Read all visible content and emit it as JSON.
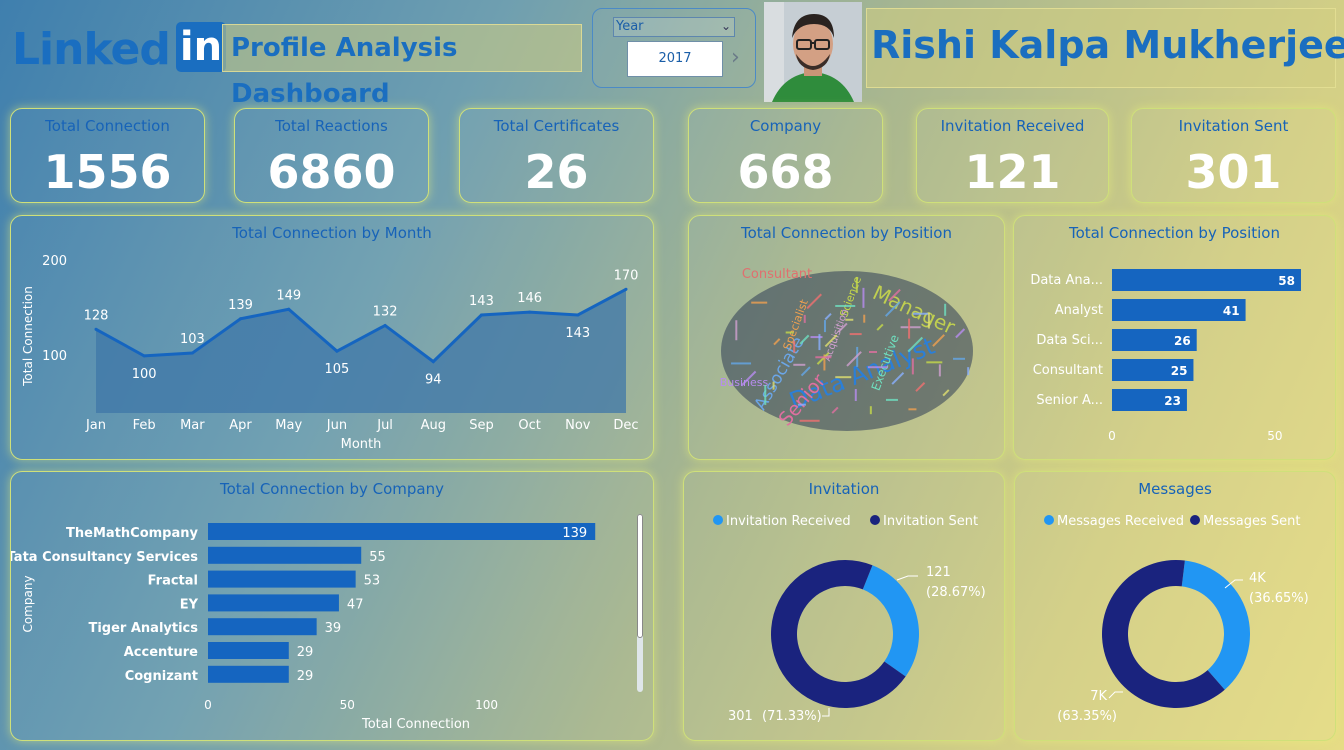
{
  "header": {
    "logo_word": "Linked",
    "logo_box": "in",
    "title": "Profile Analysis Dashboard",
    "user_name": "Rishi Kalpa Mukherjee"
  },
  "filter": {
    "label": "Year",
    "value": "2017",
    "next_icon": "chevron-right-icon",
    "dropdown_icon": "chevron-down-icon"
  },
  "kpis": [
    {
      "label": "Total Connection",
      "value": "1556"
    },
    {
      "label": "Total Reactions",
      "value": "6860"
    },
    {
      "label": "Total Certificates",
      "value": "26"
    },
    {
      "label": "Company",
      "value": "668"
    },
    {
      "label": "Invitation Received",
      "value": "121"
    },
    {
      "label": "Invitation Sent",
      "value": "301"
    }
  ],
  "colors": {
    "accent_blue": "#1a6ec0",
    "bar_blue": "#1565c0",
    "light_blue": "#2196f3",
    "dark_navy": "#1a237e",
    "area_fill": "#3f77a8"
  },
  "chart_data": [
    {
      "id": "month",
      "type": "area",
      "title": "Total Connection by Month",
      "xlabel": "Month",
      "ylabel": "Total Connection",
      "categories": [
        "Jan",
        "Feb",
        "Mar",
        "Apr",
        "May",
        "Jun",
        "Jul",
        "Aug",
        "Sep",
        "Oct",
        "Nov",
        "Dec"
      ],
      "values": [
        128,
        100,
        103,
        139,
        149,
        105,
        132,
        94,
        143,
        146,
        143,
        170
      ],
      "yticks": [
        100,
        200
      ],
      "ylim": [
        40,
        205
      ],
      "grid": false
    },
    {
      "id": "position-cloud",
      "type": "wordcloud",
      "title": "Total Connection by Position",
      "words": [
        "Data Analyst",
        "Manager",
        "Senior",
        "Associate",
        "Consultant",
        "Business",
        "Executive",
        "Specialist",
        "Science",
        "Acquisition"
      ]
    },
    {
      "id": "position",
      "type": "bar",
      "orientation": "horizontal",
      "title": "Total Connection by Position",
      "categories": [
        "Data Ana...",
        "Analyst",
        "Data Sci...",
        "Consultant",
        "Senior A..."
      ],
      "values": [
        58,
        41,
        26,
        25,
        23
      ],
      "xticks": [
        0,
        50
      ],
      "xlim": [
        0,
        62
      ]
    },
    {
      "id": "company",
      "type": "bar",
      "orientation": "horizontal",
      "title": "Total Connection by Company",
      "xlabel": "Total Connection",
      "ylabel": "Company",
      "categories": [
        "TheMathCompany",
        "Tata Consultancy Services",
        "Fractal",
        "EY",
        "Tiger Analytics",
        "Accenture",
        "Cognizant"
      ],
      "values": [
        139,
        55,
        53,
        47,
        39,
        29,
        29
      ],
      "xticks": [
        0,
        50,
        100
      ],
      "xlim": [
        0,
        140
      ]
    },
    {
      "id": "invitation",
      "type": "pie",
      "donut": true,
      "title": "Invitation",
      "legend": [
        "Invitation Received",
        "Invitation Sent"
      ],
      "values": [
        121,
        301
      ],
      "labels": [
        "121",
        "301"
      ],
      "percents": [
        "(28.67%)",
        "(71.33%)"
      ]
    },
    {
      "id": "messages",
      "type": "pie",
      "donut": true,
      "title": "Messages",
      "legend": [
        "Messages Received",
        "Messages Sent"
      ],
      "values": [
        36.65,
        63.35
      ],
      "labels": [
        "4K",
        "7K"
      ],
      "percents": [
        "(36.65%)",
        "(63.35%)"
      ]
    }
  ]
}
